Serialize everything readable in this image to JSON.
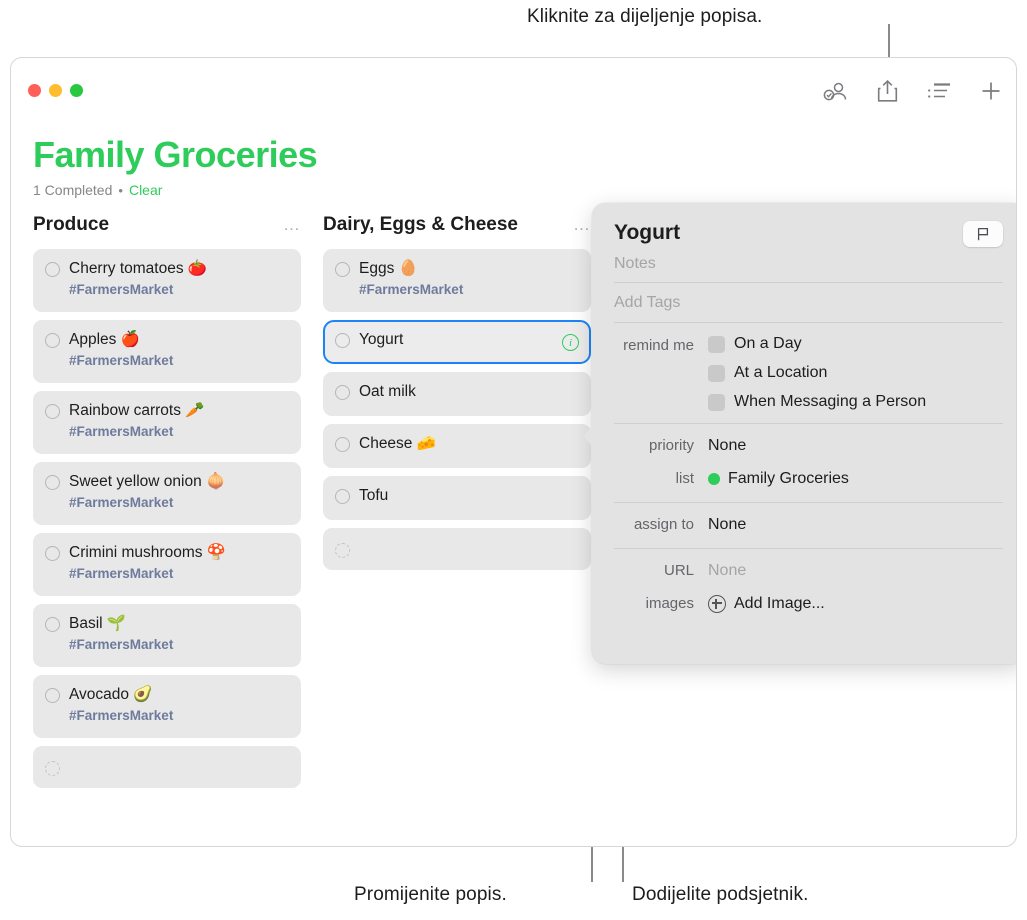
{
  "callouts": {
    "top": "Kliknite za dijeljenje popisa.",
    "bottom_left": "Promijenite popis.",
    "bottom_right": "Dodijelite podsjetnik."
  },
  "window": {
    "traffic_lights": [
      "close",
      "minimize",
      "zoom"
    ],
    "toolbar": [
      {
        "name": "assigned-to-me-icon",
        "label": "Assigned to Me"
      },
      {
        "name": "share-icon",
        "label": "Share"
      },
      {
        "name": "list-view-icon",
        "label": "View Options"
      },
      {
        "name": "add-icon",
        "label": "New Reminder"
      }
    ]
  },
  "header": {
    "title": "Family Groceries",
    "completed_count": "1 Completed",
    "separator": "•",
    "clear_label": "Clear",
    "accent_color": "#2ecc5b"
  },
  "columns": [
    {
      "name": "Produce",
      "menu": "…",
      "items": [
        {
          "title": "Cherry tomatoes 🍅",
          "tag": "#FarmersMarket",
          "selected": false
        },
        {
          "title": "Apples 🍎",
          "tag": "#FarmersMarket",
          "selected": false
        },
        {
          "title": "Rainbow carrots 🥕",
          "tag": "#FarmersMarket",
          "selected": false
        },
        {
          "title": "Sweet yellow onion 🧅",
          "tag": "#FarmersMarket",
          "selected": false
        },
        {
          "title": "Crimini mushrooms 🍄",
          "tag": "#FarmersMarket",
          "selected": false
        },
        {
          "title": "Basil 🌱",
          "tag": "#FarmersMarket",
          "selected": false
        },
        {
          "title": "Avocado 🥑",
          "tag": "#FarmersMarket",
          "selected": false
        },
        {
          "title": "",
          "tag": "",
          "selected": false,
          "empty": true
        }
      ]
    },
    {
      "name": "Dairy, Eggs & Cheese",
      "menu": "…",
      "items": [
        {
          "title": "Eggs 🥚",
          "tag": "#FarmersMarket",
          "selected": false
        },
        {
          "title": "Yogurt",
          "tag": "",
          "selected": true,
          "info": "ⓘ"
        },
        {
          "title": "Oat milk",
          "tag": "",
          "selected": false
        },
        {
          "title": "Cheese 🧀",
          "tag": "",
          "selected": false
        },
        {
          "title": "Tofu",
          "tag": "",
          "selected": false
        },
        {
          "title": "",
          "tag": "",
          "selected": false,
          "empty": true
        }
      ]
    }
  ],
  "popover": {
    "title": "Yogurt",
    "flag_label": "Flag",
    "notes_placeholder": "Notes",
    "tags_placeholder": "Add Tags",
    "remind_me_label": "remind me",
    "remind_options": [
      {
        "label": "On a Day",
        "checked": false
      },
      {
        "label": "At a Location",
        "checked": false
      },
      {
        "label": "When Messaging a Person",
        "checked": false
      }
    ],
    "priority_label": "priority",
    "priority_value": "None",
    "list_label": "list",
    "list_value": "Family Groceries",
    "list_color": "#2ecc5b",
    "assign_to_label": "assign to",
    "assign_to_value": "None",
    "url_label": "URL",
    "url_value": "None",
    "images_label": "images",
    "images_value": "Add Image..."
  }
}
